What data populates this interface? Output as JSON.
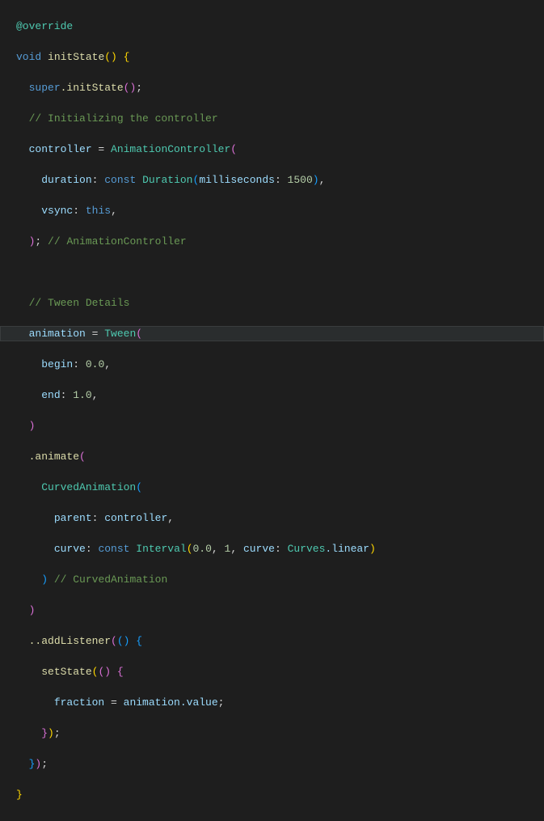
{
  "code": {
    "override": "@override",
    "void": "void",
    "initState": "initState",
    "superK": "super",
    "dotInitState": ".initState();",
    "comment_init": "// Initializing the controller",
    "controller": "controller",
    "eq": " = ",
    "AnimationController": "AnimationController",
    "duration_label": "duration",
    "constK": "const",
    "Duration": "Duration",
    "milliseconds_label": "milliseconds",
    "ms_value": "1500",
    "vsync_label": "vsync",
    "thisK": "this",
    "comment_ac": "// AnimationController",
    "comment_tween": "// Tween Details",
    "animation": "animation",
    "Tween": "Tween",
    "begin_label": "begin",
    "begin_value": "0.0",
    "end_label": "end",
    "end_value": "1.0",
    "animate": ".animate",
    "CurvedAnimation": "CurvedAnimation",
    "parent_label": "parent",
    "curve_label": "curve",
    "Interval": "Interval",
    "interval_a": "0.0",
    "interval_b": "1",
    "Curves": "Curves",
    "linear": ".linear",
    "comment_ca": "// CurvedAnimation",
    "addListener": "..addListener",
    "setState": "setState",
    "fraction": "fraction",
    "animation_value": "animation.value"
  }
}
